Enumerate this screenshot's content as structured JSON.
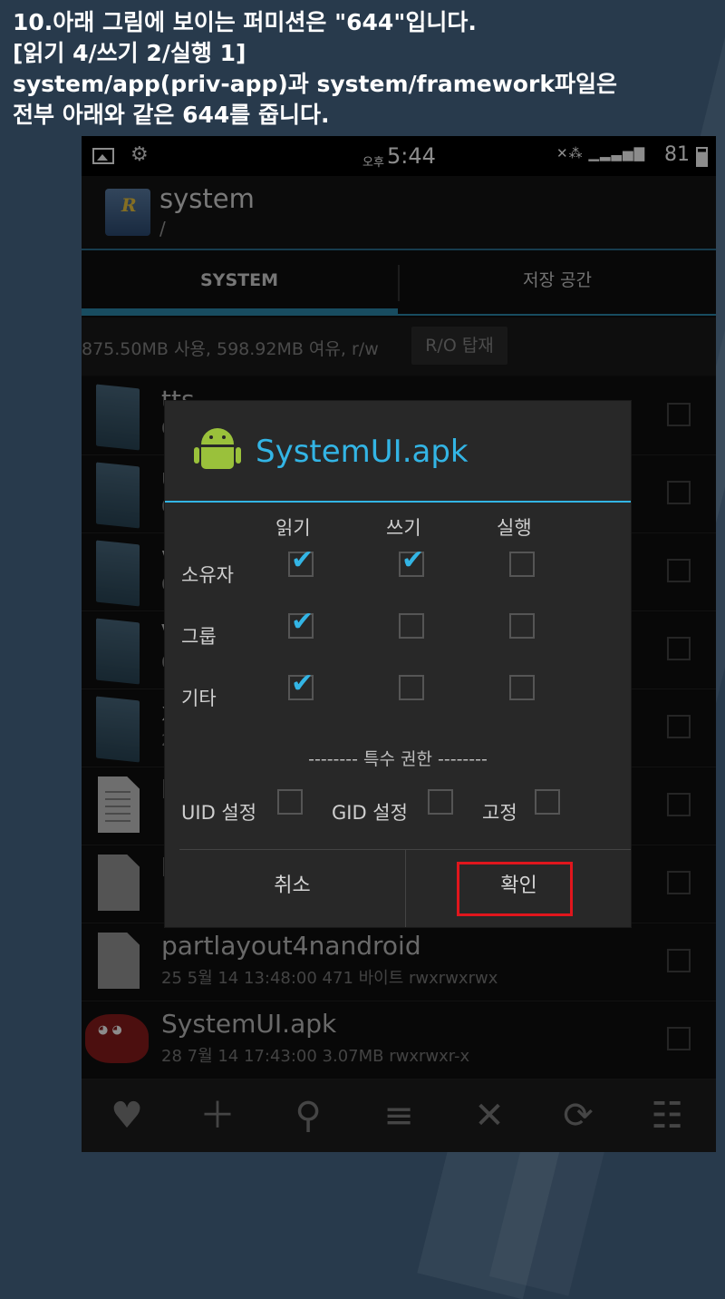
{
  "caption": [
    "10.아래 그림에 보이는 퍼미션은 \"644\"입니다.",
    "[읽기 4/쓰기 2/실행 1]",
    "system/app(priv-app)과 system/framework파일은",
    "전부 아래와 같은 644를 줍니다."
  ],
  "status_bar": {
    "ampm": "오후",
    "time": "5:44",
    "battery": "81",
    "icons": [
      "image-icon",
      "gear-icon",
      "mute-icon",
      "wifi-icon",
      "signal-icon",
      "battery-icon"
    ]
  },
  "app_bar": {
    "title": "system",
    "path": "/"
  },
  "tabs": [
    {
      "label": "SYSTEM",
      "active": true
    },
    {
      "label": "저장 공간",
      "active": false
    }
  ],
  "storage": {
    "info": "875.50MB 사용, 598.92MB 여유, r/w",
    "mount_button": "R/O 탑재"
  },
  "files": [
    {
      "name": "tts",
      "meta": "0",
      "type": "folder"
    },
    {
      "name": "u",
      "meta": "0",
      "type": "folder"
    },
    {
      "name": "v",
      "meta": "0",
      "type": "folder"
    },
    {
      "name": "V",
      "meta": "0",
      "type": "folder"
    },
    {
      "name": "x",
      "meta": "2",
      "type": "folder"
    },
    {
      "name": "b",
      "meta": "",
      "type": "doc"
    },
    {
      "name": "b",
      "meta": "",
      "type": "file"
    },
    {
      "name": "partlayout4nandroid",
      "meta": "25 5월 14 13:48:00  471 바이트  rwxrwxrwx",
      "type": "file"
    },
    {
      "name": "SystemUI.apk",
      "meta": "28 7월 14 17:43:00  3.07MB  rwxrwxr-x",
      "type": "apk"
    }
  ],
  "bottom_bar": [
    "heart-icon",
    "plus-icon",
    "search-icon",
    "sort-icon",
    "close-icon",
    "refresh-icon",
    "settings-sliders-icon"
  ],
  "dialog": {
    "title": "SystemUI.apk",
    "columns": [
      "읽기",
      "쓰기",
      "실행"
    ],
    "rows": [
      {
        "label": "소유자",
        "read": true,
        "write": true,
        "exec": false
      },
      {
        "label": "그룹",
        "read": true,
        "write": false,
        "exec": false
      },
      {
        "label": "기타",
        "read": true,
        "write": false,
        "exec": false
      }
    ],
    "special_header": "-------- 특수 권한 --------",
    "special": [
      {
        "label": "UID 설정",
        "checked": false
      },
      {
        "label": "GID 설정",
        "checked": false
      },
      {
        "label": "고정",
        "checked": false
      }
    ],
    "cancel_label": "취소",
    "ok_label": "확인"
  },
  "colors": {
    "accent": "#33b5e5",
    "highlight_box": "#e0161d",
    "page_bg": "#283a4c"
  }
}
